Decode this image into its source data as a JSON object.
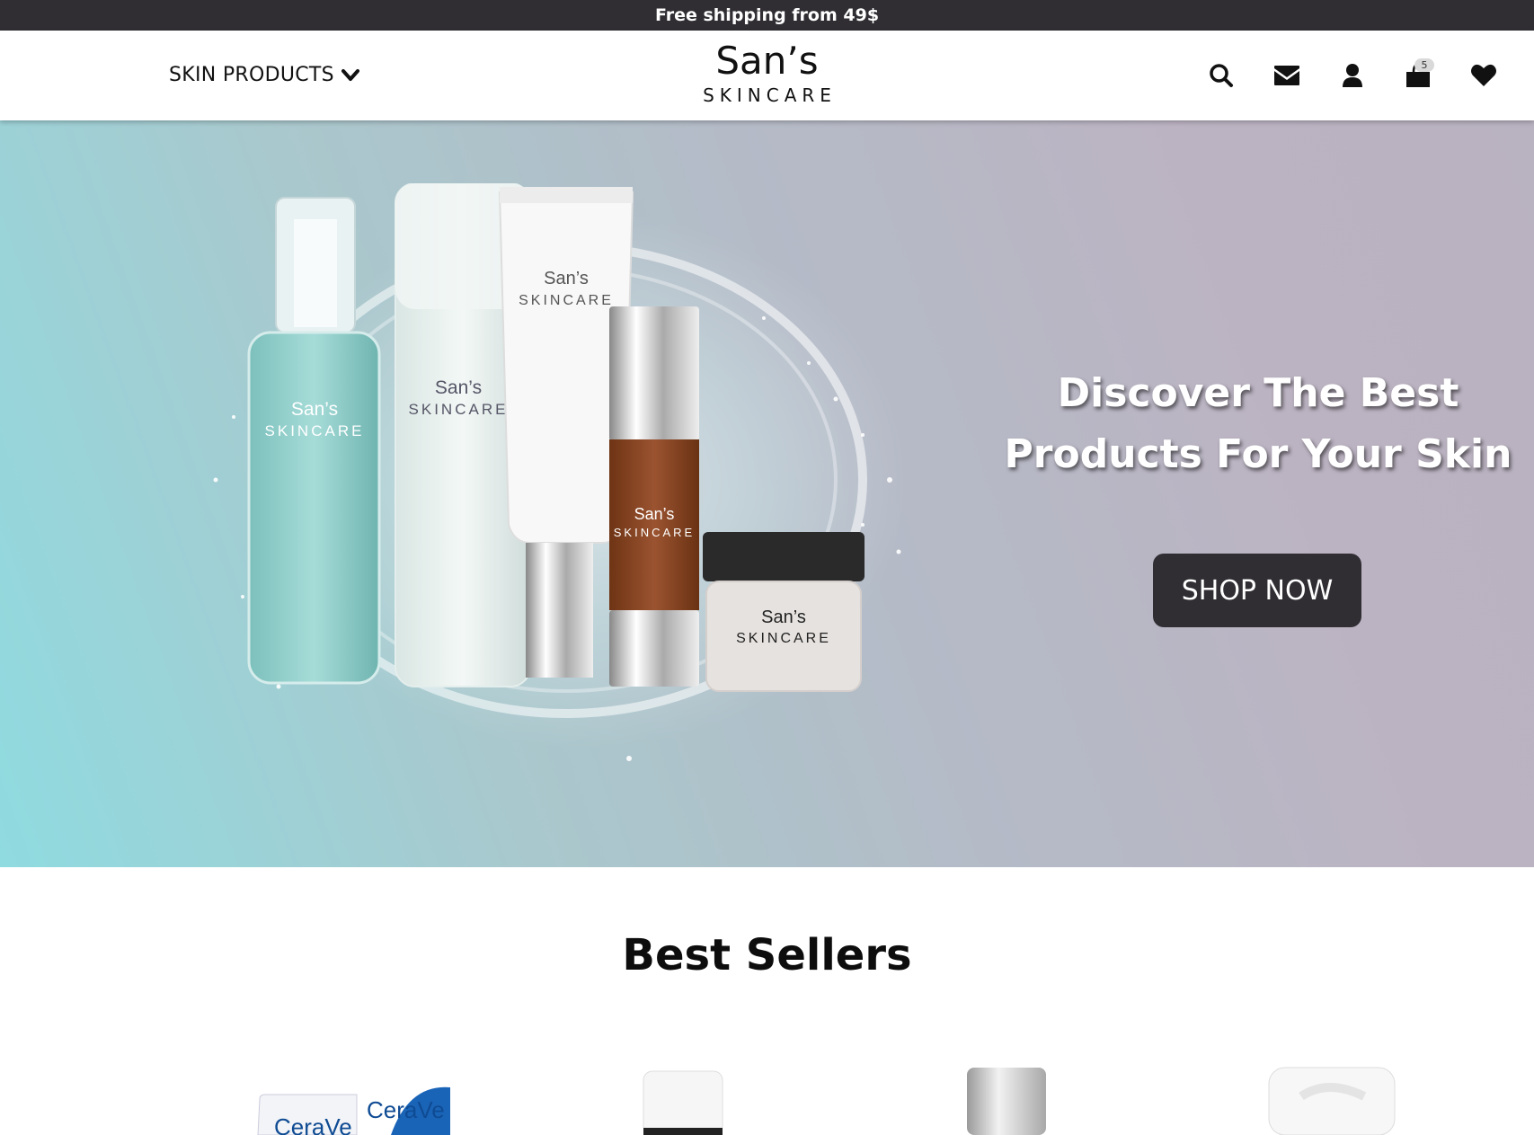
{
  "announcement": {
    "text": "Free shipping from 49$"
  },
  "header": {
    "menu_label": "SKIN PRODUCTS",
    "logo_main": "San’s",
    "logo_sub": "SKINCARE",
    "cart_count": "5",
    "icons": [
      "search-icon",
      "envelope-icon",
      "user-icon",
      "shopping-bag-icon",
      "heart-icon"
    ]
  },
  "hero": {
    "title_line1": "Discover The Best",
    "title_line2": "Products For Your Skin",
    "button_label": "SHOP NOW",
    "product_labels": {
      "brand": "San’s",
      "line": "SKINCARE"
    }
  },
  "best_sellers": {
    "title": "Best Sellers",
    "product_1_brand": "CeraVe"
  },
  "colors": {
    "dark": "#302e33",
    "accent_teal": "#8fdbe0",
    "accent_lilac": "#bcb3c2"
  }
}
